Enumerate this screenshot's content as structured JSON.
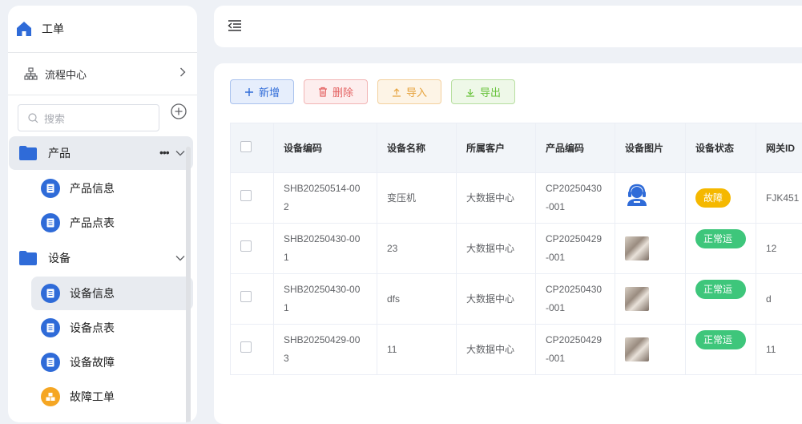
{
  "sidebar": {
    "home_label": "工单",
    "flow_label": "流程中心",
    "search_placeholder": "搜索",
    "groups": [
      {
        "label": "产品",
        "items": [
          {
            "label": "产品信息"
          },
          {
            "label": "产品点表"
          }
        ]
      },
      {
        "label": "设备",
        "items": [
          {
            "label": "设备信息"
          },
          {
            "label": "设备点表"
          },
          {
            "label": "设备故障"
          },
          {
            "label": "故障工单"
          }
        ]
      }
    ]
  },
  "toolbar": {
    "add_label": "新增",
    "delete_label": "删除",
    "import_label": "导入",
    "export_label": "导出"
  },
  "table": {
    "headers": [
      "设备编码",
      "设备名称",
      "所属客户",
      "产品编码",
      "设备图片",
      "设备状态",
      "网关ID"
    ],
    "rows": [
      {
        "code_a": "SHB20250514-00",
        "code_b": "2",
        "name": "变压机",
        "customer": "大数据中心",
        "prod_a": "CP20250430",
        "prod_b": "-001",
        "image": "headset-avatar",
        "status": "故障",
        "gateway": "FJK451"
      },
      {
        "code_a": "SHB20250430-00",
        "code_b": "1",
        "name": "23",
        "customer": "大数据中心",
        "prod_a": "CP20250429",
        "prod_b": "-001",
        "image": "photo-thumbnail",
        "status": "正常运行",
        "gateway": "12"
      },
      {
        "code_a": "SHB20250430-00",
        "code_b": "1",
        "name": "dfs",
        "customer": "大数据中心",
        "prod_a": "CP20250430",
        "prod_b": "-001",
        "image": "photo-thumbnail",
        "status": "正常运行",
        "gateway": "d"
      },
      {
        "code_a": "SHB20250429-00",
        "code_b": "3",
        "name": "11",
        "customer": "大数据中心",
        "prod_a": "CP20250429",
        "prod_b": "-001",
        "image": "photo-thumbnail",
        "status": "正常运行",
        "gateway": "11"
      }
    ]
  },
  "colors": {
    "accent": "#2f6bd8",
    "status_fault": "#f5b800",
    "status_normal": "#3ec67b",
    "orange_icon": "#f5a623"
  }
}
